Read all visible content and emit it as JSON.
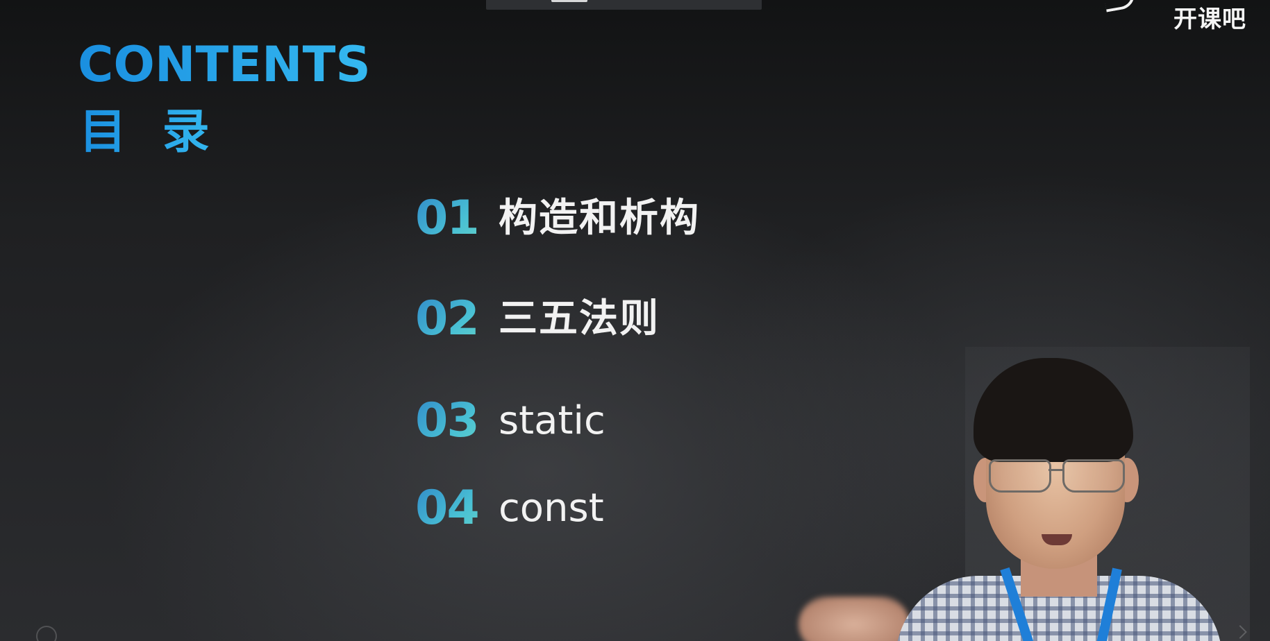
{
  "brand": {
    "name": "开课吧"
  },
  "header": {
    "title": "CONTENTS",
    "subtitle": "目 录"
  },
  "toc": [
    {
      "number": "01",
      "label": "构造和析构"
    },
    {
      "number": "02",
      "label": "三五法则"
    },
    {
      "number": "03",
      "label": "static"
    },
    {
      "number": "04",
      "label": "const"
    }
  ],
  "icons": {
    "brand_logo": "brand-swoosh-icon",
    "bottom_left": "headphone-icon",
    "bottom_right": "resize-corner-icon"
  },
  "colors": {
    "title_blue": "#1a8fe0",
    "title_cyan": "#35b9f0",
    "number_teal": "#49c0d4",
    "background": "#1c1d1f",
    "text_white": "#f2f2f2"
  }
}
